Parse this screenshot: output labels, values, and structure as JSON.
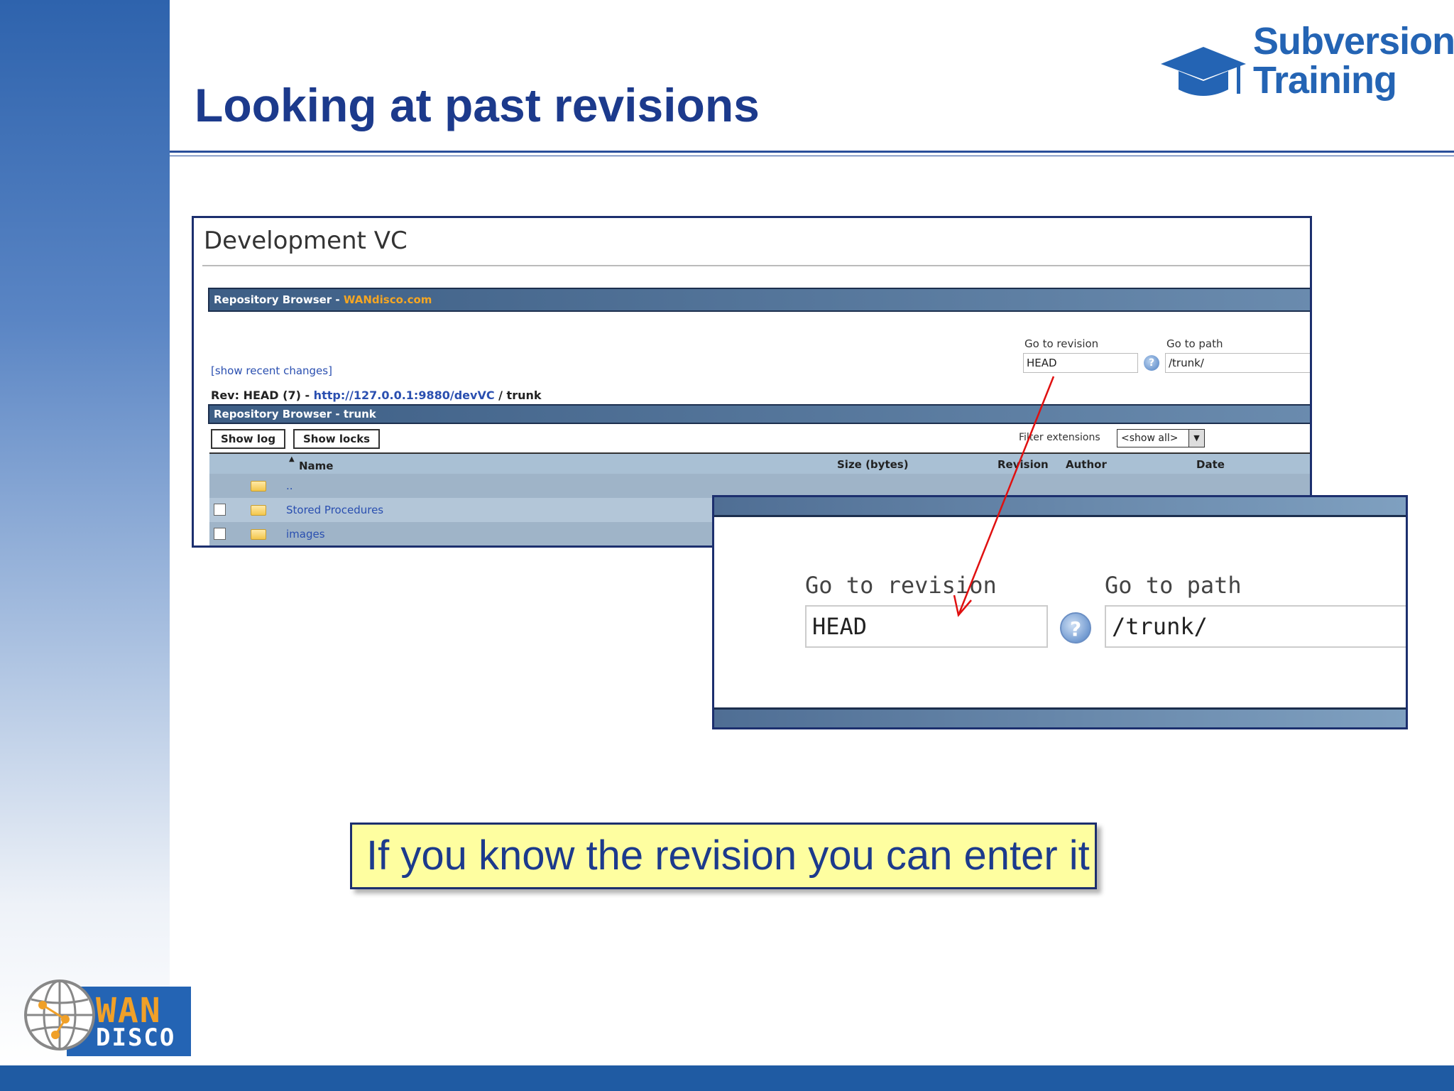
{
  "slide": {
    "title": "Looking at past revisions",
    "callout": "If you know the revision you can enter it"
  },
  "logos": {
    "subversion_line1": "Subversion",
    "subversion_line2": "Training",
    "wandisco_line1": "WAN",
    "wandisco_line2": "DISCO"
  },
  "screenshot": {
    "page_title": "Development VC",
    "header_bar": {
      "label": "Repository Browser - ",
      "link": "WANdisco.com"
    },
    "show_recent_changes": "[show recent changes]",
    "go_to_revision_label": "Go to revision",
    "go_to_revision_value": "HEAD",
    "go_to_path_label": "Go to path",
    "go_to_path_value": "/trunk/",
    "help_icon_glyph": "?",
    "rev_line": {
      "prefix": "Rev: HEAD (7) - ",
      "url": "http://127.0.0.1:9880/devVC",
      "suffix": " / trunk"
    },
    "sub_header": "Repository Browser - trunk",
    "buttons": {
      "show_log": "Show log",
      "show_locks": "Show locks"
    },
    "filter_label": "Filter extensions",
    "filter_value": "<show all>",
    "filter_arrow": "▼",
    "columns": {
      "sort_arrow": "▲",
      "name": "Name",
      "size": "Size (bytes)",
      "revision": "Revision",
      "author": "Author",
      "date": "Date"
    },
    "rows": [
      {
        "name": "..",
        "checkbox": false
      },
      {
        "name": "Stored Procedures",
        "checkbox": true
      },
      {
        "name": "images",
        "checkbox": true
      }
    ]
  },
  "zoom": {
    "go_to_revision_label": "Go to revision",
    "go_to_revision_value": "HEAD",
    "go_to_path_label": "Go to path",
    "go_to_path_value": "/trunk/",
    "help_icon_glyph": "?"
  },
  "colors": {
    "title_blue": "#1c3a8c",
    "arrow_red": "#e01010",
    "callout_yellow": "#fefea0",
    "link_orange": "#f5a623"
  }
}
